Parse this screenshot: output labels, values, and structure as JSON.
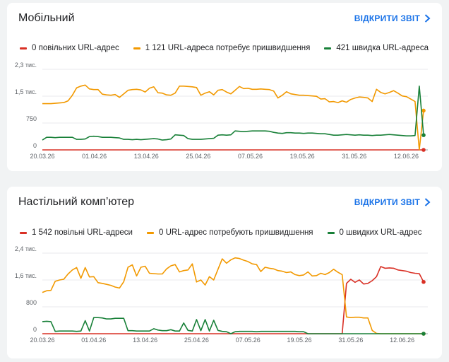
{
  "colors": {
    "slow": "#d93025",
    "improve": "#f29900",
    "fast": "#188038",
    "link": "#1a73e8"
  },
  "report_link_label": "ВІДКРИТИ ЗВІТ",
  "x_labels": [
    "20.03.26",
    "01.04.26",
    "13.04.26",
    "25.04.26",
    "07.05.26",
    "19.05.26",
    "31.05.26",
    "12.06.26"
  ],
  "mobile": {
    "title": "Мобільний",
    "legend": {
      "slow": "0 повільних URL-адрес",
      "improve": "1 121 URL-адреса потребує пришвидшення",
      "fast": "421 швидка URL-адреса"
    }
  },
  "desktop": {
    "title": "Настільний комп’ютер",
    "legend": {
      "slow": "1 542 повільні URL-адреси",
      "improve": "0 URL-адрес потребують пришвидшення",
      "fast": "0 швидких URL-адрес"
    }
  },
  "chart_data": [
    {
      "type": "line",
      "title": "Мобільний",
      "x_count": 89,
      "x_tick_labels": [
        "20.03.26",
        "01.04.26",
        "13.04.26",
        "25.04.26",
        "07.05.26",
        "19.05.26",
        "31.05.26",
        "12.06.26"
      ],
      "y_tick_labels": [
        "0",
        "750",
        "1,5 тис.",
        "2,3 тис."
      ],
      "ylim": [
        0,
        2300
      ],
      "series": [
        {
          "name": "0 повільних URL-адрес",
          "color": "#d93025",
          "values": [
            0,
            0,
            0,
            0,
            0,
            0,
            0,
            0,
            0,
            0,
            0,
            0,
            0,
            0,
            0,
            0,
            0,
            0,
            0,
            0,
            0,
            0,
            0,
            0,
            0,
            0,
            0,
            0,
            0,
            0,
            0,
            0,
            0,
            0,
            0,
            0,
            0,
            0,
            0,
            0,
            0,
            0,
            0,
            0,
            0,
            0,
            0,
            0,
            0,
            0,
            0,
            0,
            0,
            0,
            0,
            0,
            0,
            0,
            0,
            0,
            0,
            0,
            0,
            0,
            0,
            0,
            0,
            0,
            0,
            0,
            0,
            0,
            0,
            0,
            0,
            0,
            0,
            0,
            0,
            0,
            0,
            0,
            0,
            0,
            0,
            0,
            0,
            0,
            0
          ]
        },
        {
          "name": "1 121 URL-адреса потребує пришвидшення",
          "color": "#f29900",
          "values": [
            1320,
            1320,
            1320,
            1330,
            1340,
            1350,
            1400,
            1560,
            1770,
            1820,
            1850,
            1740,
            1720,
            1720,
            1590,
            1570,
            1560,
            1580,
            1500,
            1600,
            1700,
            1720,
            1730,
            1710,
            1650,
            1760,
            1800,
            1630,
            1620,
            1570,
            1560,
            1620,
            1820,
            1820,
            1810,
            1800,
            1780,
            1560,
            1620,
            1660,
            1570,
            1700,
            1720,
            1650,
            1600,
            1700,
            1810,
            1750,
            1760,
            1730,
            1730,
            1740,
            1730,
            1720,
            1680,
            1480,
            1560,
            1660,
            1600,
            1580,
            1560,
            1560,
            1550,
            1540,
            1530,
            1450,
            1460,
            1370,
            1380,
            1350,
            1400,
            1360,
            1440,
            1480,
            1510,
            1500,
            1480,
            1380,
            1730,
            1640,
            1600,
            1640,
            1690,
            1620,
            1540,
            1520,
            1450,
            1380,
            0,
            1121
          ]
        },
        {
          "name": "421 швидка URL-адреса",
          "color": "#188038",
          "values": [
            280,
            360,
            360,
            350,
            360,
            360,
            360,
            360,
            300,
            300,
            310,
            380,
            390,
            380,
            360,
            360,
            360,
            350,
            340,
            300,
            300,
            290,
            300,
            290,
            300,
            310,
            320,
            310,
            280,
            290,
            310,
            430,
            420,
            410,
            320,
            300,
            300,
            300,
            310,
            320,
            330,
            420,
            430,
            420,
            430,
            540,
            530,
            520,
            530,
            540,
            540,
            540,
            540,
            530,
            500,
            480,
            470,
            490,
            490,
            480,
            480,
            470,
            480,
            480,
            470,
            460,
            460,
            440,
            420,
            420,
            430,
            440,
            430,
            420,
            430,
            420,
            420,
            410,
            420,
            420,
            430,
            440,
            430,
            420,
            410,
            400,
            400,
            410,
            1820,
            421
          ]
        }
      ]
    },
    {
      "type": "line",
      "title": "Настільний комп’ютер",
      "x_count": 89,
      "x_tick_labels": [
        "20.03.26",
        "01.04.26",
        "13.04.26",
        "25.04.26",
        "07.05.26",
        "19.05.26",
        "31.05.26",
        "12.06.26"
      ],
      "y_tick_labels": [
        "0",
        "800",
        "1,6 тис.",
        "2,4 тис."
      ],
      "ylim": [
        0,
        2400
      ],
      "series": [
        {
          "name": "1 542 повільні URL-адреси",
          "color": "#d93025",
          "values": [
            0,
            0,
            0,
            0,
            0,
            0,
            0,
            0,
            0,
            0,
            0,
            0,
            0,
            0,
            0,
            0,
            0,
            0,
            0,
            0,
            0,
            0,
            0,
            0,
            0,
            0,
            0,
            0,
            0,
            0,
            0,
            0,
            0,
            0,
            0,
            0,
            0,
            0,
            0,
            0,
            0,
            0,
            0,
            0,
            0,
            0,
            0,
            0,
            0,
            0,
            0,
            0,
            0,
            0,
            0,
            0,
            0,
            0,
            0,
            0,
            0,
            0,
            0,
            0,
            0,
            0,
            0,
            0,
            0,
            0,
            0,
            1500,
            1620,
            1530,
            1600,
            1480,
            1500,
            1580,
            1700,
            2000,
            1950,
            1960,
            1950,
            1900,
            1880,
            1860,
            1820,
            1800,
            1790,
            1542
          ]
        },
        {
          "name": "0 URL-адрес потребують пришвидшення",
          "color": "#f29900",
          "values": [
            1230,
            1280,
            1290,
            1560,
            1600,
            1620,
            1780,
            1900,
            1970,
            1650,
            1970,
            1690,
            1700,
            1520,
            1500,
            1470,
            1440,
            1390,
            1360,
            1550,
            1980,
            2050,
            1720,
            1980,
            2010,
            1800,
            1790,
            1780,
            1780,
            1930,
            2020,
            2060,
            1840,
            1880,
            1900,
            2080,
            1540,
            1600,
            1450,
            1700,
            1600,
            1920,
            2230,
            2100,
            2200,
            2260,
            2240,
            2190,
            2150,
            2080,
            2060,
            1850,
            1980,
            1950,
            1930,
            1880,
            1860,
            1820,
            1840,
            1760,
            1730,
            1750,
            1840,
            1720,
            1730,
            1800,
            1760,
            1820,
            1920,
            1830,
            1760,
            500,
            480,
            490,
            490,
            470,
            470,
            100,
            10,
            0,
            0,
            0,
            0,
            0,
            0,
            0,
            0,
            0,
            0,
            0
          ]
        },
        {
          "name": "0 швидких URL-адрес",
          "color": "#188038",
          "values": [
            360,
            370,
            360,
            70,
            80,
            80,
            80,
            80,
            70,
            80,
            390,
            80,
            480,
            480,
            470,
            440,
            440,
            460,
            460,
            460,
            90,
            90,
            80,
            80,
            80,
            80,
            150,
            110,
            90,
            90,
            120,
            80,
            80,
            320,
            100,
            80,
            420,
            90,
            420,
            80,
            400,
            100,
            70,
            60,
            0,
            60,
            70,
            70,
            70,
            70,
            60,
            70,
            70,
            70,
            70,
            70,
            70,
            70,
            70,
            70,
            60,
            60,
            0,
            0,
            0,
            0,
            0,
            0,
            0,
            0,
            0,
            0,
            0,
            0,
            0,
            0,
            0,
            0,
            0,
            0,
            0,
            0,
            0,
            0,
            0,
            0,
            0,
            0,
            0,
            0
          ]
        }
      ]
    }
  ]
}
